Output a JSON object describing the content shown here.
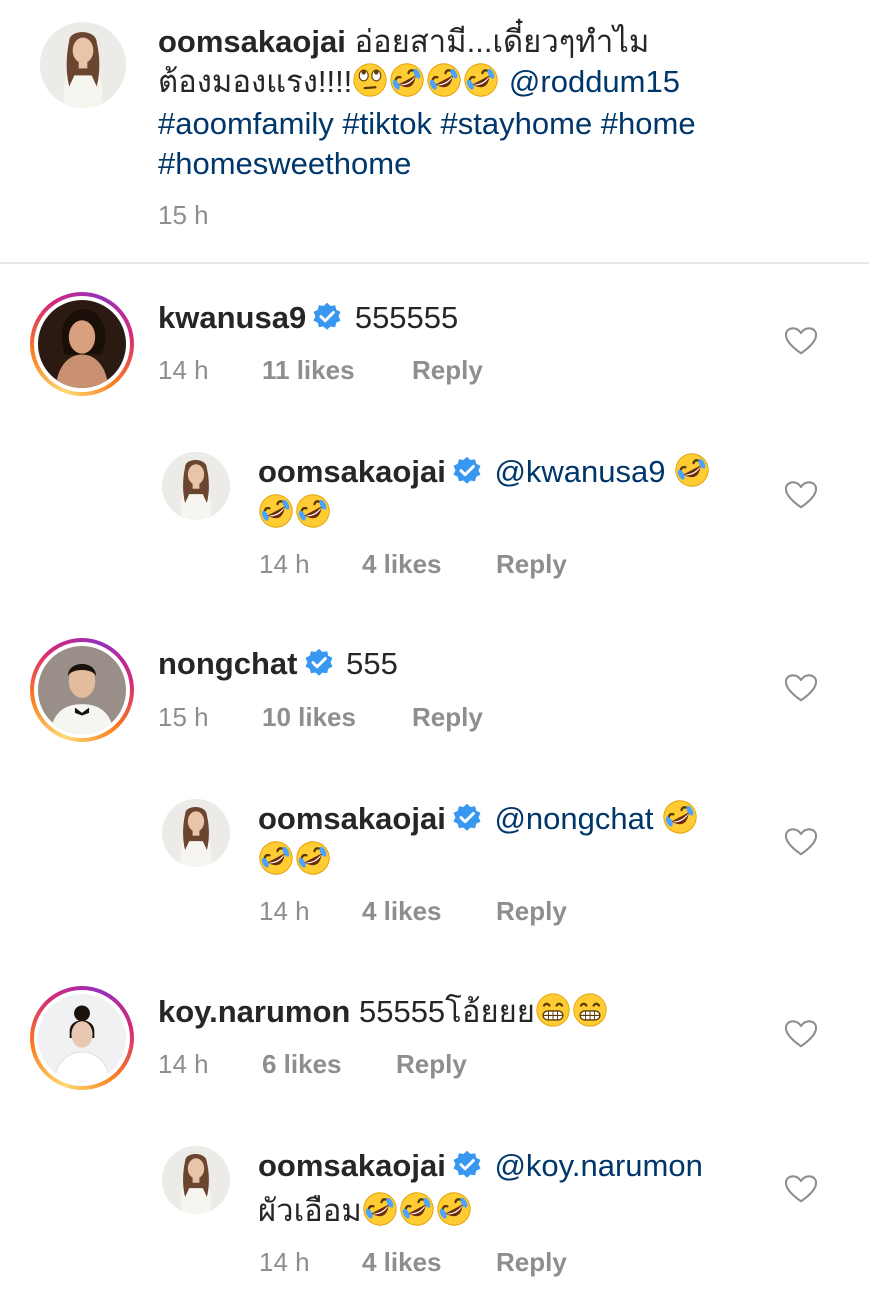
{
  "caption": {
    "username": "oomsakaojai",
    "text_line1": "อ่อยสามี...เดี๋ยวๆทำไม",
    "text_line2_prefix": "ต้องมองแรง!!!!",
    "mention": "@roddum15",
    "hashtags_line3": "#aoomfamily #tiktok #stayhome #home",
    "hashtags_line4": "#homesweethome",
    "time": "15 h"
  },
  "comments": [
    {
      "username": "kwanusa9",
      "verified": true,
      "text": "555555",
      "time": "14 h",
      "likes": "11 likes",
      "reply_label": "Reply",
      "reply": {
        "username": "oomsakaojai",
        "verified": true,
        "mention": "@kwanusa9",
        "time": "14 h",
        "likes": "4 likes",
        "reply_label": "Reply"
      }
    },
    {
      "username": "nongchat",
      "verified": true,
      "text": "555",
      "time": "15 h",
      "likes": "10 likes",
      "reply_label": "Reply",
      "reply": {
        "username": "oomsakaojai",
        "verified": true,
        "mention": "@nongchat",
        "time": "14 h",
        "likes": "4 likes",
        "reply_label": "Reply"
      }
    },
    {
      "username": "koy.narumon",
      "verified": false,
      "text": "55555โอ้ยยย",
      "time": "14 h",
      "likes": "6 likes",
      "reply_label": "Reply",
      "reply": {
        "username": "oomsakaojai",
        "verified": true,
        "mention": "@koy.narumon",
        "text_line2": "ผัวเอือม",
        "time": "14 h",
        "likes": "4 likes",
        "reply_label": "Reply"
      }
    }
  ],
  "colors": {
    "link": "#00376b",
    "verified": "#3897f0",
    "meta": "#8e8e8e",
    "text": "#262626"
  },
  "icons": {
    "verified": "verified-badge-icon",
    "like": "heart-outline-icon",
    "rofl": "rofl-emoji",
    "eye_roll": "eye-roll-emoji",
    "grin": "grin-emoji"
  }
}
